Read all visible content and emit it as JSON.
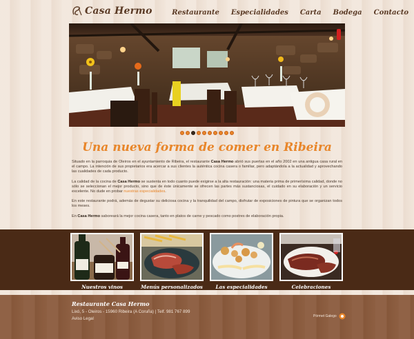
{
  "header": {
    "logo_text": "Casa Hermo",
    "nav": [
      "Restaurante",
      "Especialidades",
      "Carta",
      "Bodega",
      "Contacto"
    ]
  },
  "hero": {
    "slides_count": 10,
    "active_slide": 3
  },
  "main": {
    "headline": "Una nueva forma de comer en Ribeira",
    "p1_pre": "Situado en la parroquia de Oleiros en el ayuntamiento de Ribeira, el restaurante ",
    "p1_bold": "Casa Hermo",
    "p1_post": " abrió sus puertas en el año 2002 en una antigua casa rural en el campo. La intención de sus propietarios era acercar a sus clientes la auténtica cocina casera o familiar, pero adaptándola a la actualidad y aprovechando las cualidades de cada producto.",
    "p2_pre": "La calidad de la cocina de ",
    "p2_bold": "Casa Hermo",
    "p2_mid": " se sustenta en todo cuanto puede exigirse a la alta restauración: una materia prima de primerísima calidad, donde no sólo se seleccionan el mejor producto, sino que de éste únicamente se ofrecen las partes más sustanciosas, el cuidado en su elaboración y un servicio excelente. No dude en probar ",
    "p2_link": "nuestras especialidades",
    "p2_post": ".",
    "p3": "En este restaurante podrá, además de degustar su deliciosa cocina y la tranquilidad del campo, disfrutar de exposiciones de pintura que se organizan todos los meses.",
    "p4_pre": "En ",
    "p4_bold": "Casa Hermo",
    "p4_post": " saboreará la mejor cocina casera, tanto en platos de carne y pescado como postres de elaboración propia."
  },
  "cards": [
    {
      "caption": "Nuestros vinos"
    },
    {
      "caption": "Menús personalizados"
    },
    {
      "caption": "Las especialidades"
    },
    {
      "caption": "Celebraciones"
    }
  ],
  "footer": {
    "title": "Restaurante Casa Hermo",
    "address": "Lixó, 5 - Oleiros - 15960 Ribeira (A Coruña) | Telf. 981 767 899",
    "legal": "Aviso Legal",
    "credit": "Pórmet Galego"
  },
  "colors": {
    "accent": "#e8862a",
    "dark_band": "#4a2a16",
    "footer": "#8a5a3c",
    "text_brown": "#5a3a25"
  }
}
